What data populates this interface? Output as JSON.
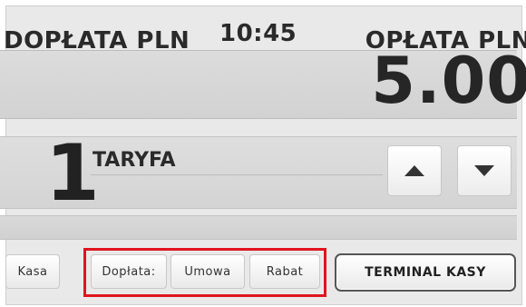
{
  "header": {
    "doplata_label": "DOPŁATA PLN",
    "clock": "10:45",
    "oplata_label": "OPŁATA PLN"
  },
  "amount": "5.00",
  "tariff": {
    "number": "1",
    "label": "TARYFA"
  },
  "buttons": {
    "kasa": "Kasa",
    "doplata": "Dopłata:",
    "umowa": "Umowa",
    "rabat": "Rabat",
    "terminal": "TERMINAL KASY"
  },
  "icons": {
    "up": "arrow-up-icon",
    "down": "arrow-down-icon"
  },
  "colors": {
    "highlight": "#e0141e"
  }
}
